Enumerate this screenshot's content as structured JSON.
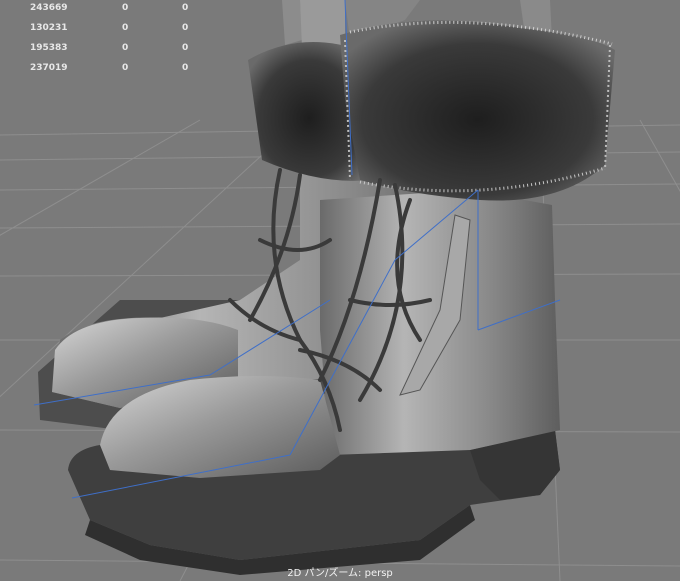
{
  "hud": {
    "rows": [
      {
        "a": "243669",
        "b": "0",
        "c": "0"
      },
      {
        "a": "130231",
        "b": "0",
        "c": "0"
      },
      {
        "a": "195383",
        "b": "0",
        "c": "0"
      },
      {
        "a": "237019",
        "b": "0",
        "c": "0"
      }
    ]
  },
  "status": {
    "label": "2D パン/ズーム: persp"
  },
  "colors": {
    "background": "#7a7a7a",
    "grid": "#8e8e8e",
    "selection_line": "#3f6fc8",
    "text": "#e8e8e8"
  }
}
